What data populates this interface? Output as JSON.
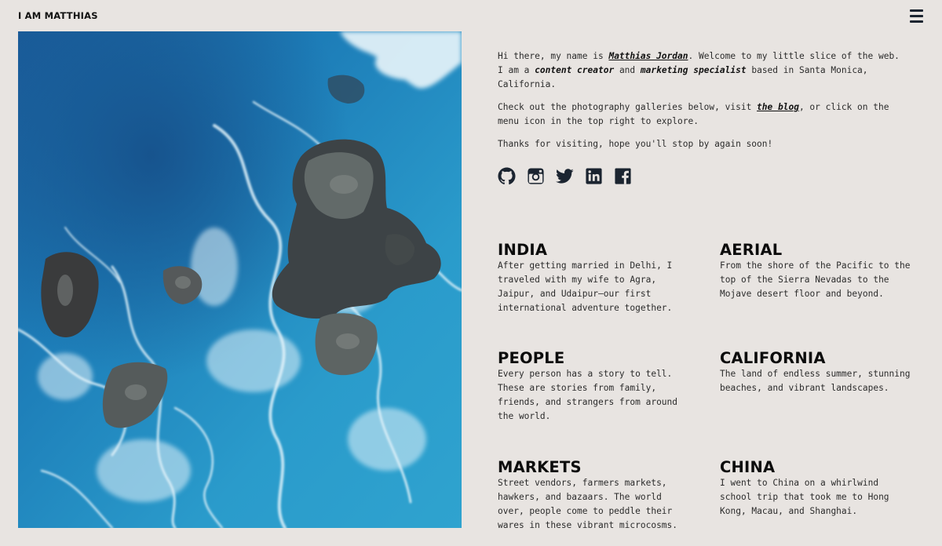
{
  "header": {
    "brand": "I AM MATTHIAS",
    "menu_icon": "hamburger-menu-icon"
  },
  "hero": {
    "image": "aerial view of ocean waves crashing on dark rocks"
  },
  "intro": {
    "p1_pre": "Hi there, my name is ",
    "p1_name": "Matthias Jordan",
    "p1_mid": ". Welcome to my little slice of the web. I am a ",
    "p1_role1": "content creator",
    "p1_and": " and ",
    "p1_role2": "marketing specialist",
    "p1_post": " based in Santa Monica, California.",
    "p2_pre": "Check out the photography galleries below, visit ",
    "p2_link": "the blog",
    "p2_post": ", or click on the menu icon in the top right to explore.",
    "p3": "Thanks for visiting, hope you'll stop by again soon!"
  },
  "socials": [
    "github-icon",
    "instagram-icon",
    "twitter-icon",
    "linkedin-icon",
    "facebook-icon"
  ],
  "colors": {
    "background": "#e8e4e1",
    "icon": "#1b2430",
    "text": "#2b2b2b",
    "heading": "#0c0c0c"
  },
  "galleries": [
    {
      "title": "INDIA",
      "desc": "After getting married in Delhi, I traveled with my wife to Agra, Jaipur, and Udaipur—our first international adventure together."
    },
    {
      "title": "AERIAL",
      "desc": "From the shore of the Pacific to the top of the Sierra Nevadas to the Mojave desert floor and beyond."
    },
    {
      "title": "PEOPLE",
      "desc": "Every person has a story to tell. These are stories from family, friends, and strangers from around the world."
    },
    {
      "title": "CALIFORNIA",
      "desc": "The land of endless summer, stunning beaches, and vibrant landscapes."
    },
    {
      "title": "MARKETS",
      "desc": "Street vendors, farmers markets, hawkers, and bazaars. The world over, people come to peddle their wares in these vibrant microcosms."
    },
    {
      "title": "CHINA",
      "desc": "I went to China on a whirlwind school trip that took me to Hong Kong, Macau, and Shanghai."
    }
  ]
}
